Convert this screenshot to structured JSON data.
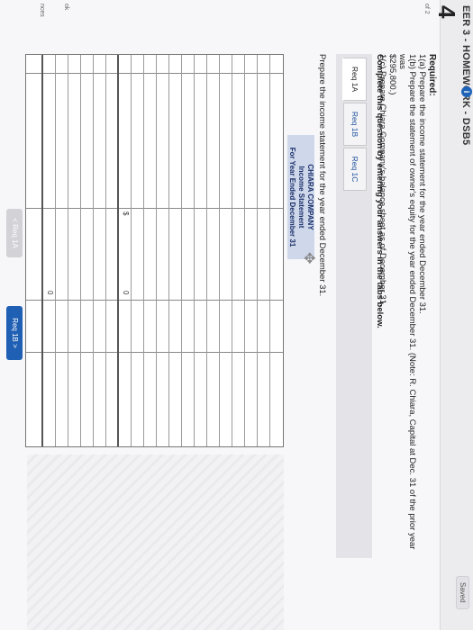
{
  "header": {
    "title": "EER 3 - HOMEWORK - DSB5",
    "info": "i",
    "saved": "Saved",
    "question_number": "4"
  },
  "left_labels": [
    "of 2",
    "ok",
    "nces"
  ],
  "requirements": {
    "heading": "Required:",
    "lines": [
      "1(a) Prepare the income statement for the year ended December 31.",
      "1(b) Prepare the statement of owner's equity for the year ended December 31. (Note: R. Chiara, Capital at Dec. 31 of the prior year was",
      "$295,800.)",
      "1(c) Prepare Chiara Company's balance sheet as of December 31."
    ]
  },
  "instruction": "Complete this question by entering your answers in the tabs below.",
  "tabs": [
    {
      "label": "Req 1A"
    },
    {
      "label": "Req 1B"
    },
    {
      "label": "Req 1C"
    }
  ],
  "prompt": "Prepare the income statement for the year ended December 31.",
  "statement": {
    "company": "CHIARA COMPANY",
    "title": "Income Statement",
    "period": "For Year Ended December 31"
  },
  "table": {
    "currency": "$",
    "totals": [
      "0",
      "0"
    ]
  },
  "navigation": {
    "prev": "< Req 1A",
    "next": "Req 1B  >"
  }
}
